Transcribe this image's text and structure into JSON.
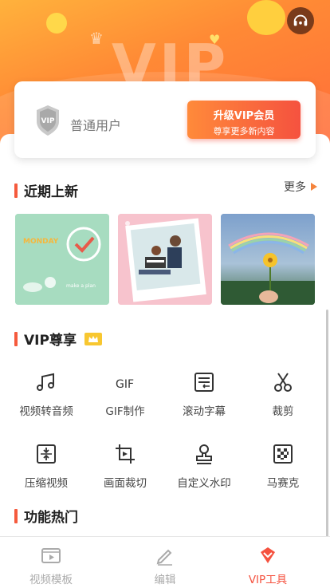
{
  "user": {
    "level_label": "普通用户",
    "badge_text": "VIP",
    "upgrade_title": "升级VIP会员",
    "upgrade_subtitle": "尊享更多新内容"
  },
  "hero": {
    "watermark": "VIP"
  },
  "recent": {
    "title": "近期上新",
    "more_label": "更多",
    "items": [
      {
        "name": "monday-template",
        "caption_top": "MONDAY",
        "caption_bottom": "make a plan"
      },
      {
        "name": "couple-photo-template"
      },
      {
        "name": "rainbow-flower-template"
      }
    ]
  },
  "vip": {
    "title": "VIP尊享",
    "tools": [
      {
        "label": "视频转音频",
        "icon": "music-note-icon"
      },
      {
        "label": "GIF制作",
        "icon": "gif-icon"
      },
      {
        "label": "滚动字幕",
        "icon": "scrolling-subtitle-icon"
      },
      {
        "label": "裁剪",
        "icon": "scissors-icon"
      },
      {
        "label": "压缩视频",
        "icon": "compress-icon"
      },
      {
        "label": "画面裁切",
        "icon": "crop-icon"
      },
      {
        "label": "自定义水印",
        "icon": "stamp-icon"
      },
      {
        "label": "马赛克",
        "icon": "mosaic-icon"
      }
    ]
  },
  "hot": {
    "title": "功能热门"
  },
  "tabbar": {
    "tabs": [
      {
        "label": "视频模板",
        "icon": "video-template-icon",
        "active": false
      },
      {
        "label": "编辑",
        "icon": "edit-icon",
        "active": false
      },
      {
        "label": "VIP工具",
        "icon": "vip-tools-icon",
        "active": true
      }
    ]
  },
  "colors": {
    "accent": "#f5523f",
    "header_start": "#ffb23c",
    "header_end": "#ff6a3a"
  }
}
